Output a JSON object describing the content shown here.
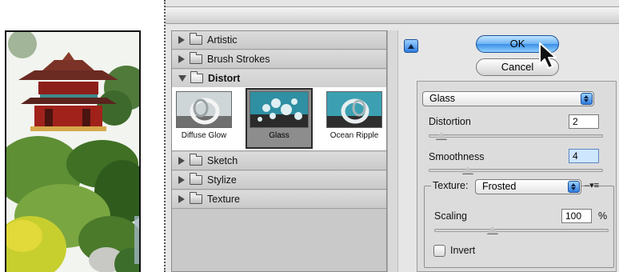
{
  "filter_gallery": {
    "categories": [
      {
        "label": "Artistic",
        "expanded": false
      },
      {
        "label": "Brush Strokes",
        "expanded": false
      },
      {
        "label": "Distort",
        "expanded": true
      },
      {
        "label": "Sketch",
        "expanded": false
      },
      {
        "label": "Stylize",
        "expanded": false
      },
      {
        "label": "Texture",
        "expanded": false
      }
    ],
    "distort_filters": [
      {
        "label": "Diffuse Glow",
        "selected": false
      },
      {
        "label": "Glass",
        "selected": true
      },
      {
        "label": "Ocean Ripple",
        "selected": false
      }
    ]
  },
  "buttons": {
    "ok_label": "OK",
    "cancel_label": "Cancel"
  },
  "settings": {
    "filter_select": "Glass",
    "distortion": {
      "label": "Distortion",
      "value": "2",
      "slider_fraction": 0.1
    },
    "smoothness": {
      "label": "Smoothness",
      "value": "4",
      "slider_fraction": 0.3
    },
    "texture": {
      "label": "Texture:",
      "value": "Frosted",
      "menu_icon": "texture-menu-icon"
    },
    "scaling": {
      "label": "Scaling",
      "value": "100",
      "unit": "%",
      "slider_fraction": 0.35
    },
    "invert": {
      "label": "Invert",
      "checked": false
    }
  },
  "colors": {
    "accent_blue": "#3b8fe6",
    "dialog_bg": "#e6e6e6",
    "panel_bg": "#c9c9c9"
  }
}
